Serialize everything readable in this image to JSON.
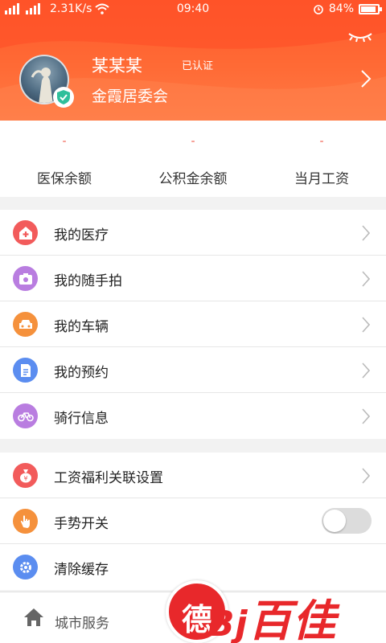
{
  "status_bar": {
    "network": "2.31K/s",
    "time": "09:40",
    "battery": "84%",
    "battery_level": 0.84
  },
  "profile": {
    "name": "某某某",
    "verified": "已认证",
    "committee": "金霞居委会"
  },
  "summary": [
    {
      "value": "-",
      "label": "医保余额"
    },
    {
      "value": "-",
      "label": "公积金余额"
    },
    {
      "value": "-",
      "label": "当月工资"
    }
  ],
  "menu_group1": [
    {
      "label": "我的医疗",
      "icon": "medical-cross-icon",
      "color": "#f25b5b"
    },
    {
      "label": "我的随手拍",
      "icon": "camera-icon",
      "color": "#b97de0"
    },
    {
      "label": "我的车辆",
      "icon": "car-icon",
      "color": "#f5913c"
    },
    {
      "label": "我的预约",
      "icon": "document-icon",
      "color": "#5b8df0"
    },
    {
      "label": "骑行信息",
      "icon": "bicycle-icon",
      "color": "#b97de0"
    }
  ],
  "menu_group2": [
    {
      "label": "工资福利关联设置",
      "icon": "money-bag-icon",
      "color": "#f25b5b"
    },
    {
      "label": "手势开关",
      "icon": "hand-icon",
      "color": "#f5913c",
      "toggle": false
    },
    {
      "label": "清除缓存",
      "icon": "gear-icon",
      "color": "#5b8df0"
    }
  ],
  "bottom_nav": {
    "label": "城市服务"
  },
  "watermark": {
    "logo_char": "德",
    "text": "百佳"
  },
  "colors": {
    "header": "#ff6a35",
    "accent_red": "#f05a4a"
  }
}
